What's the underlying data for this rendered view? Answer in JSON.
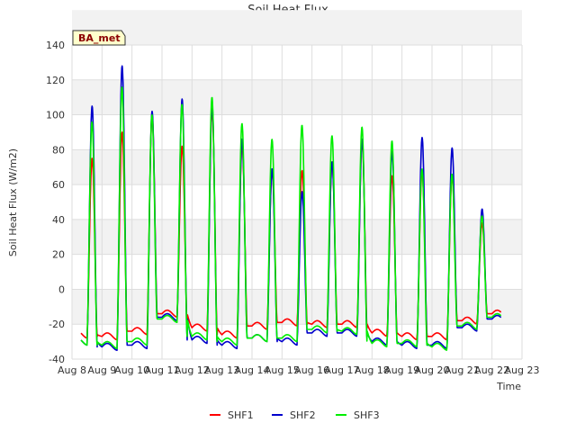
{
  "chart_data": {
    "type": "line",
    "title": "Soil Heat Flux",
    "xlabel": "Time",
    "ylabel": "Soil Heat Flux (W/m2)",
    "ylim": [
      -40,
      140
    ],
    "yticks": [
      -40,
      -20,
      0,
      20,
      40,
      60,
      80,
      100,
      120,
      140
    ],
    "xlim": [
      "Aug 8",
      "Aug 23"
    ],
    "xticks": [
      "Aug 8",
      "Aug 9",
      "Aug 10",
      "Aug 11",
      "Aug 12",
      "Aug 13",
      "Aug 14",
      "Aug 15",
      "Aug 16",
      "Aug 17",
      "Aug 18",
      "Aug 19",
      "Aug 20",
      "Aug 21",
      "Aug 22",
      "Aug 23"
    ],
    "grid": true,
    "tag": "BA_met",
    "legend_position": "bottom",
    "data_start_day": 8.3,
    "data_end_day": 22.3,
    "series": [
      {
        "name": "SHF1",
        "color": "#ff0000",
        "daily_peaks": [
          75,
          90,
          100,
          82,
          103,
          83,
          68,
          68,
          73,
          85,
          65,
          68,
          65,
          38
        ],
        "daily_minima": [
          -26,
          -27,
          -24,
          -14,
          -22,
          -26,
          -21,
          -19,
          -20,
          -20,
          -25,
          -27,
          -27,
          -18,
          -14
        ]
      },
      {
        "name": "SHF2",
        "color": "#0000cc",
        "daily_peaks": [
          105,
          128,
          102,
          109,
          106,
          86,
          69,
          56,
          73,
          86,
          79,
          87,
          81,
          46
        ],
        "daily_minima": [
          -30,
          -33,
          -32,
          -16,
          -29,
          -32,
          -28,
          -30,
          -25,
          -25,
          -30,
          -32,
          -32,
          -22,
          -17
        ]
      },
      {
        "name": "SHF3",
        "color": "#00ee00",
        "daily_peaks": [
          96,
          116,
          100,
          106,
          110,
          95,
          86,
          94,
          88,
          93,
          85,
          69,
          66,
          42
        ],
        "daily_minima": [
          -30,
          -32,
          -30,
          -17,
          -27,
          -30,
          -28,
          -28,
          -23,
          -24,
          -31,
          -31,
          -33,
          -21,
          -16
        ]
      }
    ]
  }
}
